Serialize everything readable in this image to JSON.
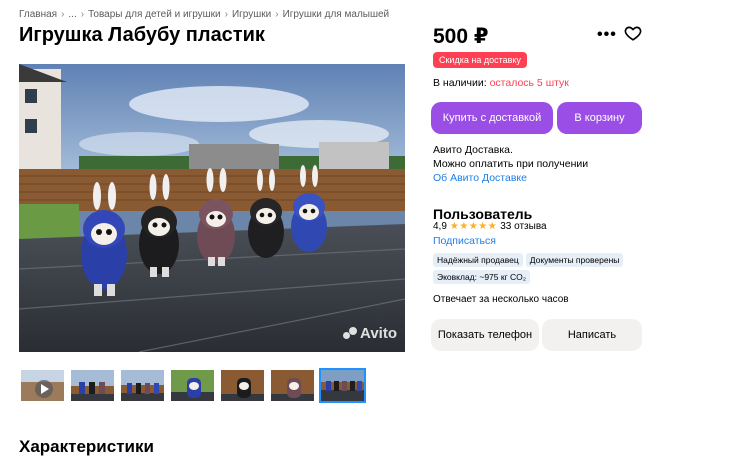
{
  "breadcrumb": {
    "items": [
      "Главная",
      "...",
      "Товары для детей и игрушки",
      "Игрушки",
      "Игрушки для малышей"
    ]
  },
  "listing": {
    "title": "Игрушка Лабубу пластик",
    "price": "500 ₽",
    "badge": "Скидка на доставку",
    "availability_label": "В наличии:",
    "availability_value": "осталось 5 штук",
    "watermark": "Avito"
  },
  "actions": {
    "buy_with_delivery": "Купить с доставкой",
    "add_to_cart": "В корзину",
    "show_phone": "Показать телефон",
    "write": "Написать"
  },
  "delivery": {
    "line1": "Авито Доставка.",
    "line2": "Можно оплатить при получении",
    "about_link": "Об Авито Доставке"
  },
  "seller": {
    "name": "Пользователь",
    "rating": "4,9",
    "stars": "★★★★★",
    "reviews": "33 отзыва",
    "subscribe": "Подписаться",
    "tags": [
      "Надёжный продавец",
      "Документы проверены",
      "Эковклад: ~975 кг CO₂"
    ],
    "response_time": "Отвечает за несколько часов"
  },
  "sections": {
    "characteristics": "Характеристики"
  },
  "gallery": {
    "thumb_count": 7,
    "active_index": 6
  },
  "colors": {
    "accent_purple": "#9b4ee6",
    "badge_red": "#ff4053",
    "link_blue": "#1f7ee6",
    "star_yellow": "#ffb021"
  }
}
